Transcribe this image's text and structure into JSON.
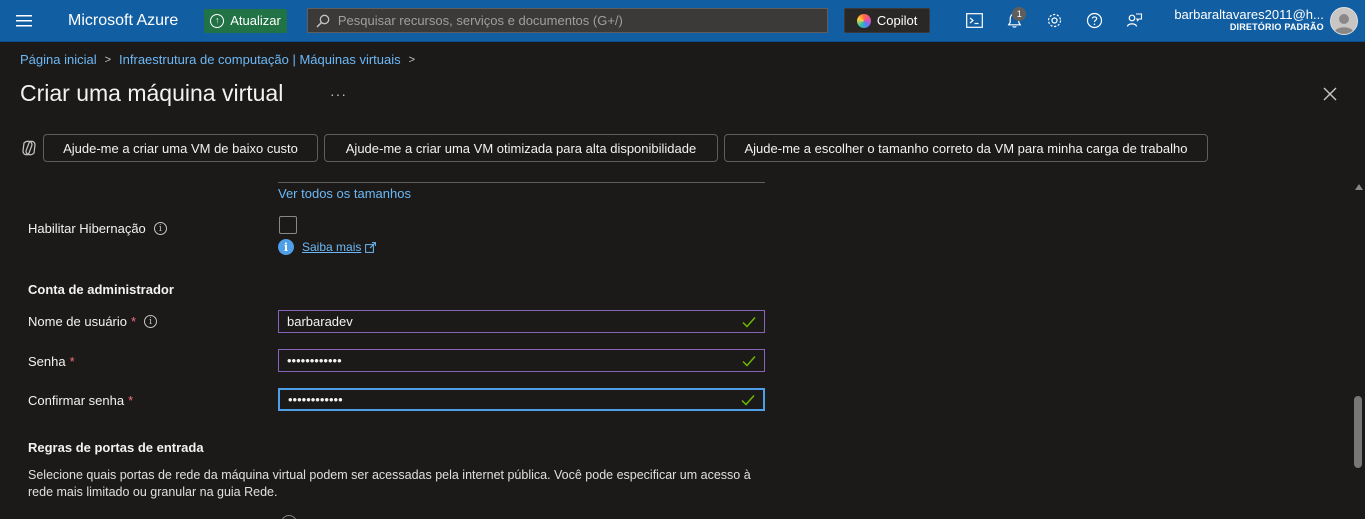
{
  "topbar": {
    "brand": "Microsoft Azure",
    "upgrade_label": "Atualizar",
    "search_placeholder": "Pesquisar recursos, serviços e documentos (G+/)",
    "copilot_label": "Copilot",
    "notification_count": "1",
    "account_email": "barbaraltavares2011@h...",
    "account_directory": "DIRETÓRIO PADRÃO",
    "icons": [
      "menu-icon",
      "cloud-shell-icon",
      "bell-icon",
      "gear-icon",
      "help-icon",
      "feedback-icon"
    ]
  },
  "breadcrumb": {
    "items": [
      "Página inicial",
      "Infraestrutura de computação | Máquinas virtuais"
    ]
  },
  "page": {
    "title": "Criar uma máquina virtual",
    "more": "···"
  },
  "copilot_chips": [
    "Ajude-me a criar uma VM de baixo custo",
    "Ajude-me a criar uma VM otimizada para alta disponibilidade",
    "Ajude-me a escolher o tamanho correto da VM para minha carga de trabalho"
  ],
  "form": {
    "see_all_sizes": "Ver todos os tamanhos",
    "hibernation_label": "Habilitar Hibernação",
    "hibernation_checked": false,
    "learn_more": "Saiba mais",
    "admin_section": "Conta de administrador",
    "username_label": "Nome de usuário",
    "username_value": "barbaradev",
    "password_label": "Senha",
    "password_value": "••••••••••••",
    "confirm_label": "Confirmar senha",
    "confirm_value": "••••••••••••",
    "required_mark": "*",
    "ports_section": "Regras de portas de entrada",
    "ports_description": "Selecione quais portas de rede da máquina virtual podem ser acessadas pela internet pública. Você pode especificar um acesso à rede mais limitado ou granular na guia Rede."
  },
  "colors": {
    "topbar": "#115ea3",
    "background": "#1b1a19",
    "link": "#6cb8f6",
    "valid_border": "#8764b8",
    "focus_border": "#4f9ee8",
    "required": "#f1707b",
    "check": "#6bb700"
  }
}
